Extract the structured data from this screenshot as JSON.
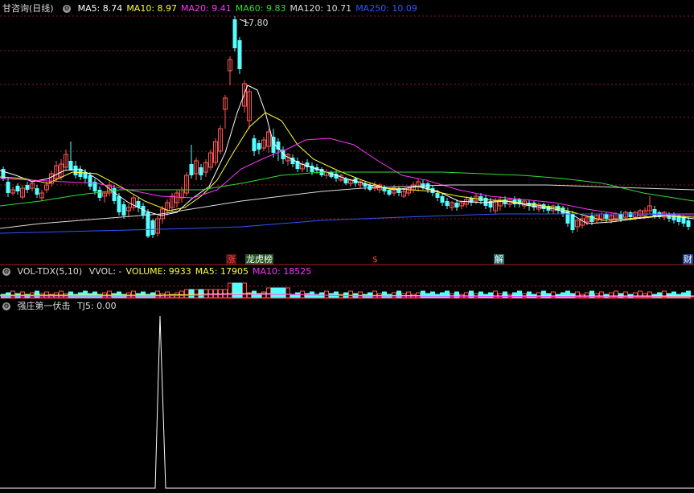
{
  "main_panel": {
    "title": "甘咨询(日线)",
    "indicators": [
      {
        "label": "MA5: 8.74",
        "color": "#ffffff"
      },
      {
        "label": "MA10: 8.97",
        "color": "#ffff33"
      },
      {
        "label": "MA20: 9.41",
        "color": "#ff33ff"
      },
      {
        "label": "MA60: 9.83",
        "color": "#33dd33"
      },
      {
        "label": "MA120: 10.71",
        "color": "#dddddd"
      },
      {
        "label": "MA250: 10.09",
        "color": "#3355ff"
      }
    ],
    "peak_price": "17.80",
    "event_tags": [
      {
        "text": "涨",
        "color": "#ff4444",
        "bg": "#551111"
      },
      {
        "text": "龙虎榜",
        "color": "#ffffff",
        "bg": "#225522"
      },
      {
        "text": "$",
        "color": "#ff3333",
        "bg": "#000000"
      },
      {
        "text": "解",
        "color": "#ffffff",
        "bg": "#1f6f6f"
      },
      {
        "text": "财",
        "color": "#ffffff",
        "bg": "#1f3f8f"
      }
    ]
  },
  "volume_panel": {
    "title": "VOL-TDX(5,10)",
    "items": [
      {
        "label": "VVOL: -",
        "color": "#dddddd"
      },
      {
        "label": "VOLUME: 9933",
        "color": "#ffff33"
      },
      {
        "label": "MA5: 17905",
        "color": "#ffff33"
      },
      {
        "label": "MA10: 18525",
        "color": "#ff33ff"
      }
    ]
  },
  "signal_panel": {
    "title": "强庄第一伏击",
    "items": [
      {
        "label": "TJ5: 0.00",
        "color": "#dddddd"
      }
    ]
  },
  "colors": {
    "up": "#ff5555",
    "down": "#55ffff",
    "grid": "#8b1a1a",
    "separator": "#aa2222"
  }
}
